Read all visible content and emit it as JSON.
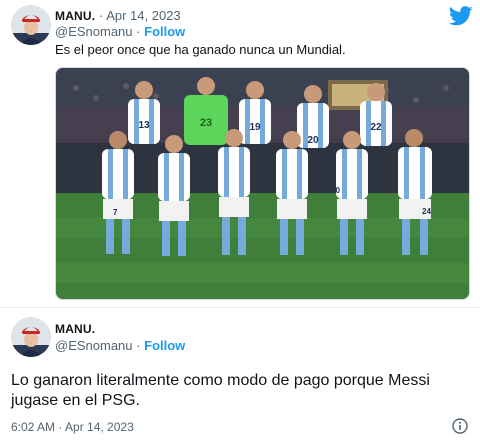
{
  "colors": {
    "accent": "#1d9bf0",
    "text": "#0f1419",
    "muted": "#536471",
    "jersey_blue": "#75aadb",
    "keeper_green": "#5bd65b"
  },
  "tweet1": {
    "author_name": "MANU.",
    "separator": "·",
    "date": "Apr 14, 2023",
    "handle": "@ESnomanu",
    "follow_label": "Follow",
    "text": "Es el peor once que ha ganado nunca un Mundial.",
    "brand_icon": "twitter-bird-icon",
    "media": {
      "description_icon": "team-photo",
      "jersey_numbers_back": [
        "13",
        "23",
        "19",
        "20",
        "22"
      ],
      "jersey_numbers_front": [
        "7",
        "10",
        "24"
      ]
    }
  },
  "tweet2": {
    "author_name": "MANU.",
    "handle": "@ESnomanu",
    "follow_label": "Follow",
    "text": "Lo ganaron literalmente como modo de pago porque Messi jugase en el PSG.",
    "timestamp": "6:02 AM · Apr 14, 2023",
    "info_icon": "info-icon"
  }
}
